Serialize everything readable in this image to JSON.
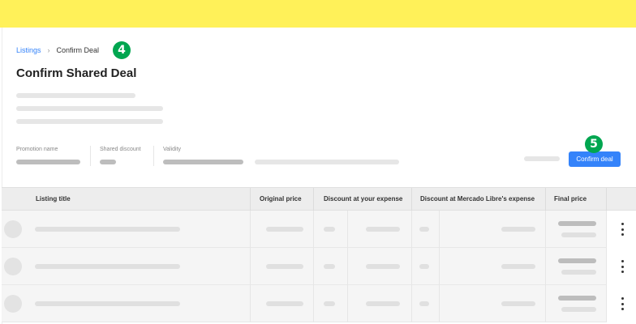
{
  "breadcrumb": {
    "parent": "Listings",
    "separator": "›",
    "current": "Confirm Deal"
  },
  "steps": {
    "step_a": "4",
    "step_b": "5"
  },
  "page": {
    "title": "Confirm Shared Deal"
  },
  "filters": {
    "promotion_name_label": "Promotion name",
    "shared_discount_label": "Shared discount",
    "validity_label": "Validity"
  },
  "actions": {
    "confirm_label": "Confirm deal"
  },
  "table": {
    "headers": {
      "listing_title": "Listing title",
      "original_price": "Original price",
      "discount_your_expense": "Discount at your expense",
      "discount_ml_expense": "Discount at Mercado Libre's expense",
      "final_price": "Final price"
    }
  },
  "colors": {
    "topbar": "#fff159",
    "primary": "#3483fa",
    "step_badge": "#00a650"
  },
  "icons": {
    "row_menu": "more-vertical-icon"
  }
}
